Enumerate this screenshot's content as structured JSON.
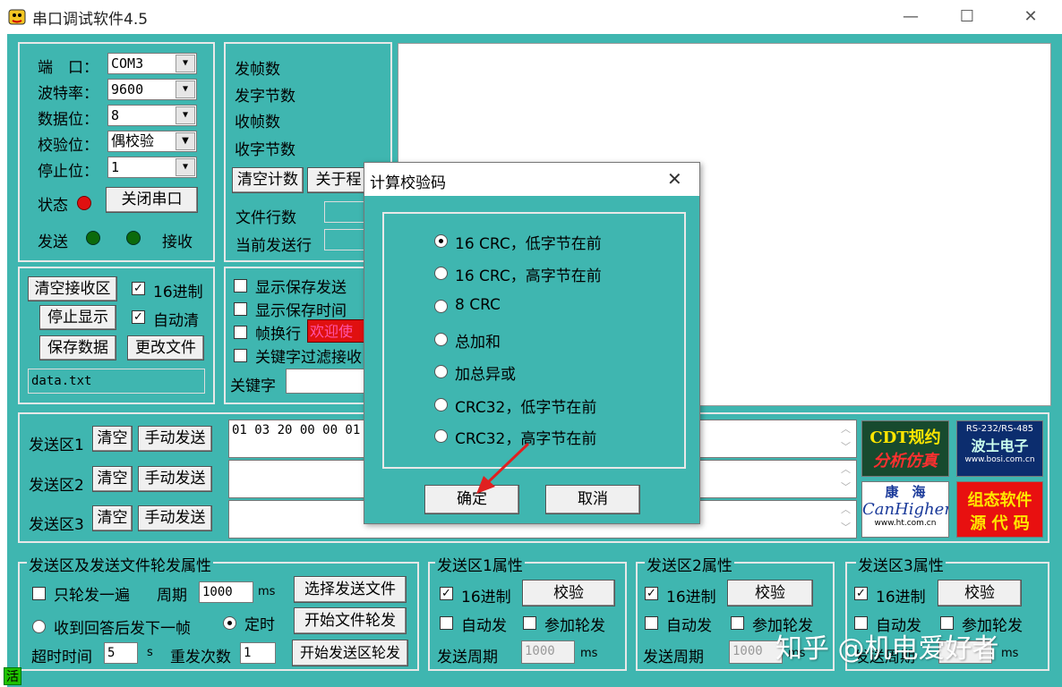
{
  "window": {
    "title": "串口调试软件4.5",
    "minimize": "—",
    "maximize": "☐",
    "close": "✕"
  },
  "port": {
    "port_label": "端　口：",
    "port_value": "COM3",
    "baud_label": "波特率：",
    "baud_value": "9600",
    "data_label": "数据位：",
    "data_value": "8",
    "parity_label": "校验位：",
    "parity_value": "偶校验",
    "stop_label": "停止位：",
    "stop_value": "1",
    "status_label": "状态",
    "close_port_button": "关闭串口",
    "send_label": "发送",
    "recv_label": "接收"
  },
  "counters": {
    "sent_frames": "发帧数",
    "sent_bytes": "发字节数",
    "recv_frames": "收帧数",
    "recv_bytes": "收字节数",
    "clear_count_button": "清空计数",
    "about_button": "关于程",
    "file_lines": "文件行数",
    "current_line": "当前发送行"
  },
  "recv_ctrl": {
    "clear_recv_button": "清空接收区",
    "hex_label": "16进制",
    "hex_checked": true,
    "stop_display_button": "停止显示",
    "auto_clear_label": "自动清",
    "auto_clear_checked": true,
    "save_data_button": "保存数据",
    "change_file_button": "更改文件",
    "filename": "data.txt"
  },
  "display_opts": {
    "show_saved_send": "显示保存发送",
    "show_saved_time": "显示保存时间",
    "frame_newline": "帧换行",
    "welcome": "欢迎使",
    "keyword_filter": "关键字过滤接收",
    "keyword_label": "关键字"
  },
  "send_areas": [
    {
      "label": "发送区1",
      "clear": "清空",
      "manual": "手动发送",
      "content": "01 03 20 00 00 01"
    },
    {
      "label": "发送区2",
      "clear": "清空",
      "manual": "手动发送",
      "content": ""
    },
    {
      "label": "发送区3",
      "clear": "清空",
      "manual": "手动发送",
      "content": ""
    }
  ],
  "ads": {
    "cdt_line1": "CDT规约",
    "cdt_line2": "分析仿真",
    "bosi_top": "RS-232/RS-485",
    "bosi_mid": "波士电子",
    "bosi_url": "www.bosi.com.cn",
    "kh_cn": "康　海",
    "kh_en": "CanHigher",
    "kh_url": "www.ht.com.cn",
    "zt_line1": "组态软件",
    "zt_line2": "源 代 码"
  },
  "poll": {
    "legend": "发送区及发送文件轮发属性",
    "only_once": "只轮发一遍",
    "period_label": "周期",
    "period_value": "1000",
    "ms": "ms",
    "select_file_button": "选择发送文件",
    "next_on_reply": "收到回答后发下一帧",
    "timed": "定时",
    "start_file_button": "开始文件轮发",
    "timeout_label": "超时时间",
    "timeout_value": "5",
    "s": "s",
    "retry_label": "重发次数",
    "retry_value": "1",
    "start_area_button": "开始发送区轮发"
  },
  "area_props": [
    {
      "legend": "发送区1属性",
      "hex": "16进制",
      "check": "校验",
      "auto": "自动发",
      "poll": "参加轮发",
      "period": "发送周期",
      "period_value": "1000",
      "ms": "ms"
    },
    {
      "legend": "发送区2属性",
      "hex": "16进制",
      "check": "校验",
      "auto": "自动发",
      "poll": "参加轮发",
      "period": "发送周期",
      "period_value": "1000",
      "ms": "ms"
    },
    {
      "legend": "发送区3属性",
      "hex": "16进制",
      "check": "校验",
      "auto": "自动发",
      "poll": "参加轮发",
      "period": "发送周期",
      "period_value": "",
      "ms": "ms"
    }
  ],
  "status_bar": {
    "indicator": "活"
  },
  "dialog": {
    "title": "计算校验码",
    "close": "✕",
    "options": [
      "16 CRC，低字节在前",
      "16 CRC，高字节在前",
      "8 CRC",
      "总加和",
      "加总异或",
      "CRC32，低字节在前",
      "CRC32，高字节在前"
    ],
    "selected_index": 0,
    "ok_button": "确定",
    "cancel_button": "取消"
  },
  "watermark": "知乎 @机电爱好者",
  "colors": {
    "teal": "#3fb6b0",
    "led_red": "#e01010",
    "led_green": "#0c6a0c",
    "welcome_bg": "#e01010",
    "arrow": "#e02020"
  }
}
